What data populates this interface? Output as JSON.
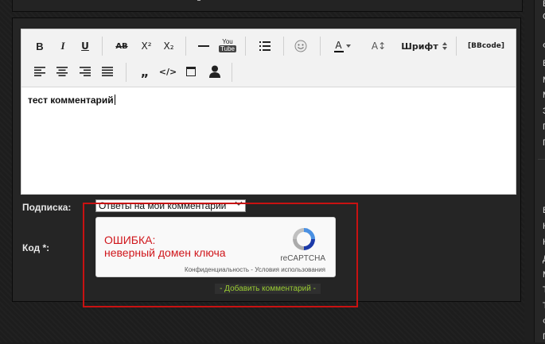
{
  "toolbar": {
    "buttons": [
      {
        "label": "B"
      },
      {
        "label": "I"
      },
      {
        "label": "U"
      },
      {
        "label": "AB"
      },
      {
        "label": "X²"
      },
      {
        "label": "X₂"
      },
      {
        "label": "—"
      },
      {
        "label": "You Tube"
      },
      {
        "label": "list"
      },
      {
        "label": "smiley"
      },
      {
        "label": "A"
      },
      {
        "label": "A↕"
      },
      {
        "label": "Шрифт"
      },
      {
        "label": "[BBcode]"
      },
      {
        "label": "left"
      },
      {
        "label": "center"
      },
      {
        "label": "right"
      },
      {
        "label": "justify"
      },
      {
        "label": "„"
      },
      {
        "label": "</>"
      },
      {
        "label": "box"
      },
      {
        "label": "user"
      }
    ],
    "font_label": "Шрифт",
    "bbcode_label": "[BBcode]",
    "youtube_top": "You",
    "youtube_bottom": "Tube"
  },
  "editor": {
    "content": "тест комментарий"
  },
  "form": {
    "subscription_label": "Подписка:",
    "subscription_value": "Ответы на мои комментарии",
    "code_label": "Код *:",
    "submit_label": "- Добавить комментарий -"
  },
  "recaptcha": {
    "error_line1": "ОШИБКА:",
    "error_line2": "неверный домен ключа",
    "brand": "reCAPTCHA",
    "links": "Конфиденциальность - Условия использования"
  },
  "sidebar": {
    "items": [
      "В",
      "С",
      "Ф",
      "В",
      "М",
      "М",
      "З",
      "П",
      "П",
      "В",
      "К",
      "К",
      "Д",
      "М",
      "Т",
      "Т",
      "Ф",
      "П"
    ]
  },
  "colors": {
    "error": "#d0161b",
    "highlight_box": "#c81212",
    "submit_text": "#9acd32"
  }
}
